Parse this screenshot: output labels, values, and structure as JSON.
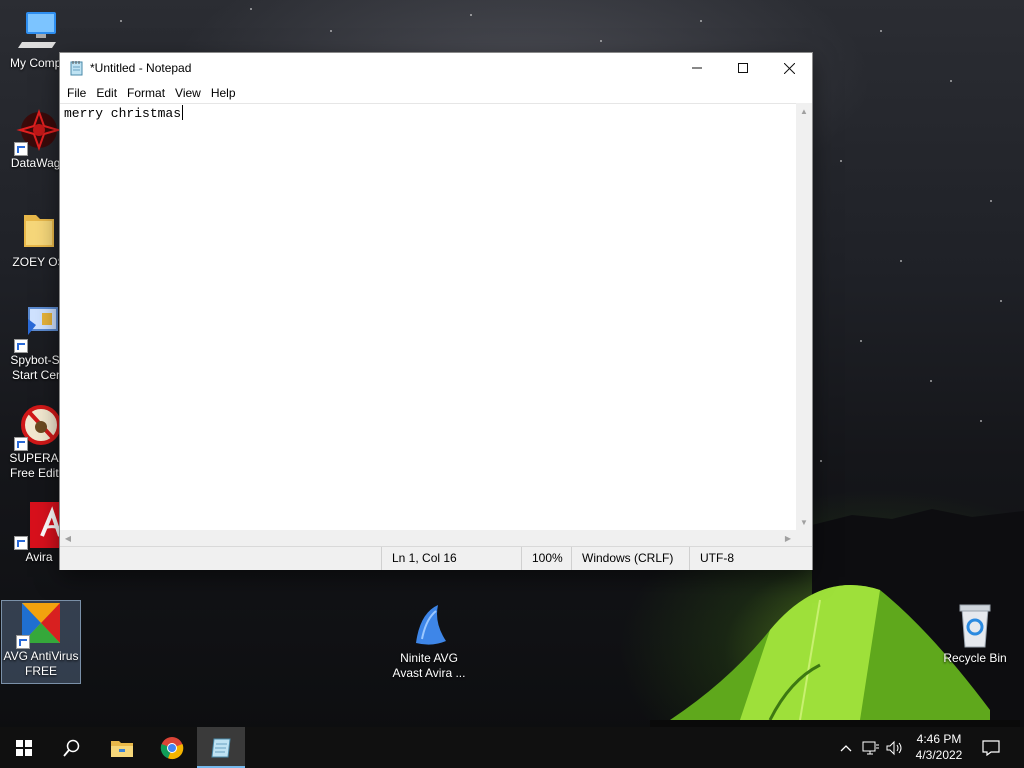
{
  "desktop": {
    "icons": [
      {
        "label": "My Compu",
        "icon": "computer-icon"
      },
      {
        "label": "DataWago",
        "icon": "datawagon-icon"
      },
      {
        "label": "ZOEY OS",
        "icon": "folder-icon"
      },
      {
        "label": "Spybot-S&\nStart Cent",
        "icon": "spybot-icon"
      },
      {
        "label": "SUPERAnt\nFree Editio",
        "icon": "superantispyware-icon"
      },
      {
        "label": "Avira",
        "icon": "avira-icon"
      },
      {
        "label": "AVG AntiVirus\nFREE",
        "icon": "avg-icon"
      },
      {
        "label": "Ninite AVG\nAvast Avira ...",
        "icon": "ninite-icon"
      },
      {
        "label": "Recycle Bin",
        "icon": "recycle-bin-icon"
      }
    ]
  },
  "notepad": {
    "title": "*Untitled - Notepad",
    "menu": [
      "File",
      "Edit",
      "Format",
      "View",
      "Help"
    ],
    "content": "merry christmas",
    "status": {
      "position": "Ln 1, Col 16",
      "zoom": "100%",
      "line_ending": "Windows (CRLF)",
      "encoding": "UTF-8"
    }
  },
  "taskbar": {
    "time": "4:46 PM",
    "date": "4/3/2022",
    "apps": [
      "start-icon",
      "search-icon",
      "file-explorer-icon",
      "chrome-icon",
      "notepad-icon"
    ]
  },
  "colors": {
    "accent": "#76b9ed",
    "avira_red": "#d8101c",
    "tent_green": "#8fd62a"
  }
}
